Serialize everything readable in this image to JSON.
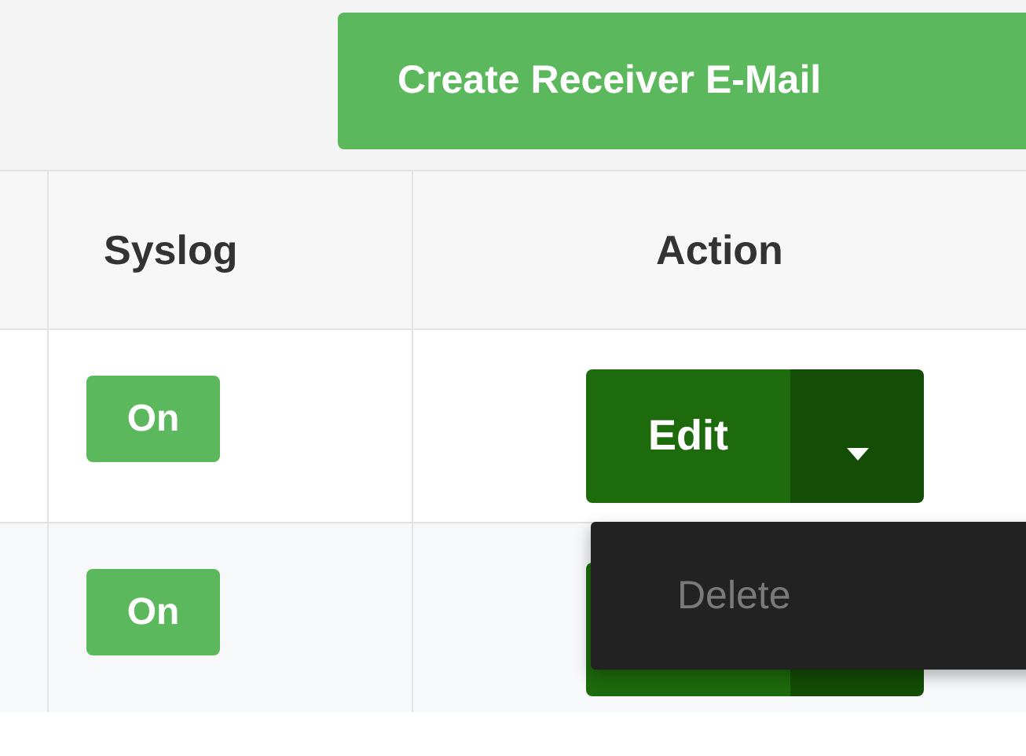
{
  "toolbar": {
    "create_button": "Create Receiver E-Mail"
  },
  "table": {
    "columns": [
      "Syslog",
      "Action"
    ],
    "rows": [
      {
        "syslog": "On",
        "action": "Edit",
        "menu": {
          "items": [
            "Delete"
          ]
        }
      },
      {
        "syslog": "On"
      }
    ]
  }
}
